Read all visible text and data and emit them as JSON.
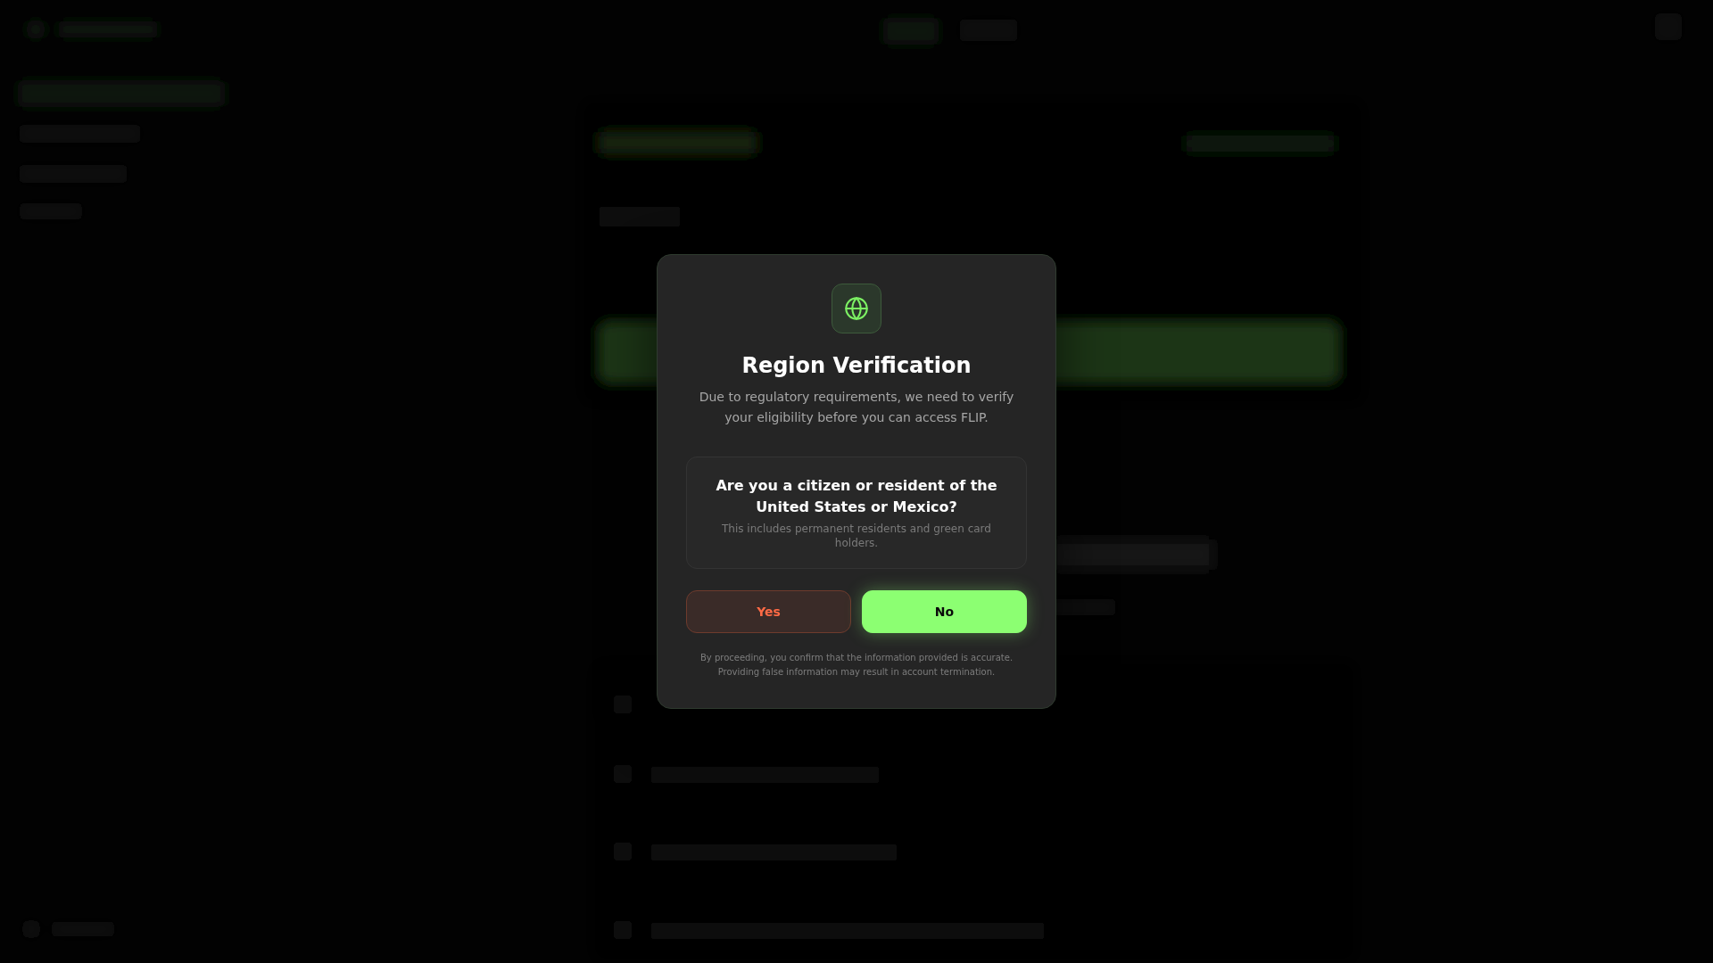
{
  "dialog": {
    "title": "Region Verification",
    "description": "Due to regulatory requirements, we need to verify your eligibility before you can access FLIP.",
    "question": {
      "title": "Are you a citizen or resident of the United States or Mexico?",
      "note": "This includes permanent residents and green card holders."
    },
    "buttons": [
      {
        "label": "Yes",
        "kind": "danger"
      },
      {
        "label": "No",
        "kind": "primary"
      }
    ],
    "disclaimer": "By proceeding, you confirm that the information provided is accurate. Providing false information may result in account termination."
  }
}
